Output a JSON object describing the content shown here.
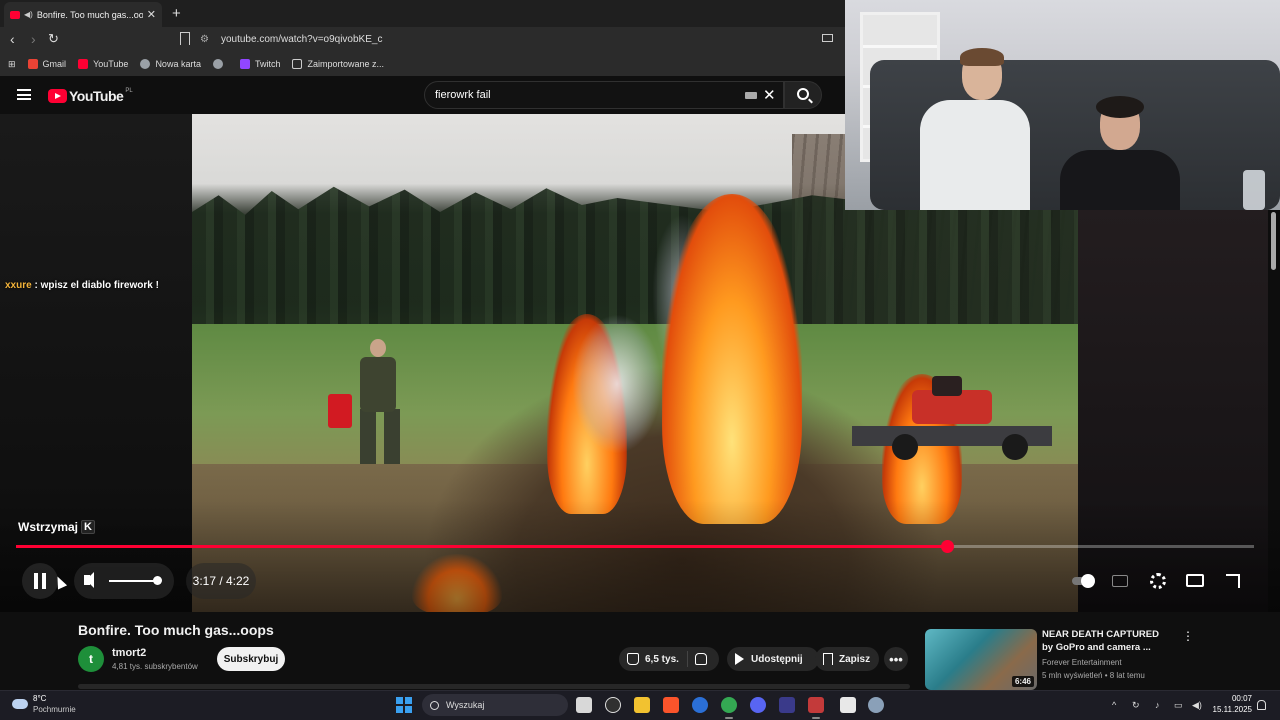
{
  "browser": {
    "tab_title": "Bonfire. Too much gas...oops",
    "tab_close": "✕",
    "new_tab": "+",
    "url": "youtube.com/watch?v=o9qivobKE_c",
    "bookmarks": [
      {
        "label": "Gmail",
        "color": "#ea4335"
      },
      {
        "label": "YouTube",
        "color": "#ff0033"
      },
      {
        "label": "Nowa karta",
        "color": "#9aa0a6"
      },
      {
        "label": "",
        "color": "#9aa0a6"
      },
      {
        "label": "Twitch",
        "color": "#9146ff"
      },
      {
        "label": "Zaimportowane z...",
        "color": "#c8c8c8"
      }
    ]
  },
  "youtube": {
    "logo_text": "YouTube",
    "logo_region": "PL",
    "search_value": "fierowrk fail",
    "clear_icon": "✕"
  },
  "chat": {
    "user": "xxure",
    "message": " : wpisz el diablo firework !"
  },
  "player": {
    "tooltip": "Wstrzymaj",
    "tooltip_key": "K",
    "current_time": "3:17",
    "duration": "4:22",
    "time_display": "3:17 / 4:22",
    "progress_fraction": 0.752,
    "volume_fraction": 1.0,
    "accent_color": "#ff0033"
  },
  "video": {
    "title": "Bonfire. Too much gas...oops",
    "channel_initial": "t",
    "channel_name": "tmort2",
    "subscribers": "4,81 tys. subskrybentów",
    "subscribe_label": "Subskrybuj",
    "likes": "6,5 tys.",
    "share_label": "Udostępnij",
    "save_label": "Zapisz",
    "more_label": "•••"
  },
  "recommendation": {
    "title": "NEAR DEATH CAPTURED by GoPro and camera ...",
    "channel": "Forever Entertainment",
    "meta": "5 mln wyświetleń • 8 lat temu",
    "duration": "6:46",
    "menu": "⋮"
  },
  "taskbar": {
    "temperature": "8°C",
    "weather": "Pochmurnie",
    "search_label": "Wyszukaj",
    "time": "00:07",
    "date": "15.11.2025"
  }
}
